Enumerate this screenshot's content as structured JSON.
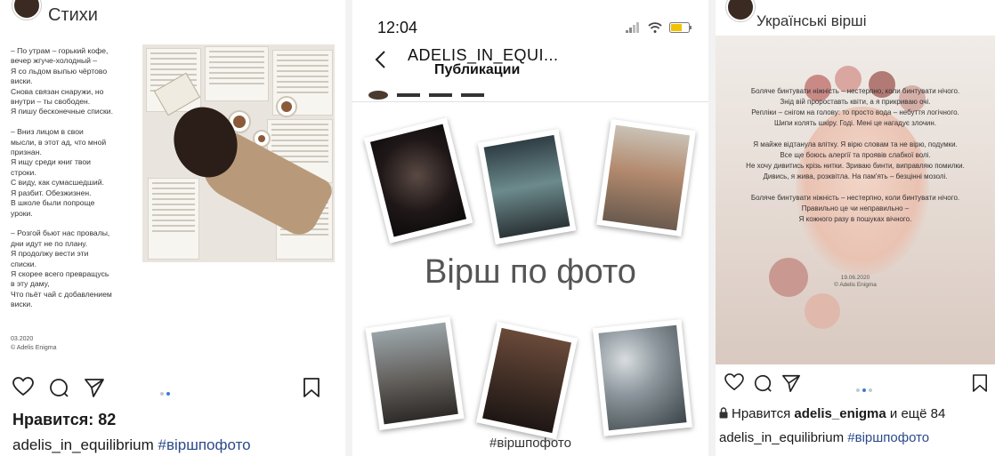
{
  "panel1": {
    "title": "Стихи",
    "poem": "– По утрам – горький кофе,\nвечер жгуче-холодный –\nЯ со льдом выпью чёртово\nвиски.\nСнова связан снаружи, но\nвнутри – ты свободен.\nЯ пишу бесконечные списки.\n\n– Вниз лицом в свои\nмысли, в этот ад, что мной\nпризнан.\nЯ ищу среди книг твои\nстроки.\nС виду, как сумасшедший.\nЯ разбит. Обезжизнен.\nВ школе были попроще\nуроки.\n\n– Розгой бьют нас провалы,\nдни идут не по плану.\nЯ продолжу вести эти\nсписки.\nЯ скорее всего превращусь\nв эту даму,\nЧто пьёт чай с добавлением\nвиски.",
    "signature": "03.2020\n© Adelis Enigma",
    "likes": "Нравится: 82",
    "caption_user": "adelis_in_equilibrium",
    "caption_tag": "#віршпофото"
  },
  "panel2": {
    "time": "12:04",
    "nav_user": "ADELIS_IN_EQUI...",
    "nav_subtitle": "Публикации",
    "main_text": "Вірш по фото",
    "hashtag": "#віршпофото"
  },
  "panel3": {
    "title": "Українські вірші",
    "poem": "Боляче бинтувати ніжність – нестерпно, коли бинтувати нічого.\nЗнід вій пророставть квіти, а я прикриваю очі.\nРепліки – снігом на голову: то просто вода – небуття логічного.\nШипи колять шкіру. Годі. Мені це нагадує злочин.\n\nЯ майже відтанула влітку. Я вірю словам та не вірю, подумки.\nВсе ще боюсь алергії та проявів слабкої волі.\nНе хочу дивитись крізь нитки. Зриваю бинти, виправляю помилки.\nДивись, я жива, розквітла. На пам'ять – безцінні мозолі.\n\nБоляче бинтувати ніжність – нестерпно, коли бинтувати нічого.\nПравильно це чи неправильно –\nЯ кожного разу в пошуках вічного.",
    "signature": "19.06.2020\n© Adelis Enigma",
    "likes_prefix": "Нравится ",
    "likes_user": "adelis_enigma",
    "likes_suffix": " и ещё 84",
    "caption_user": "adelis_in_equilibrium",
    "caption_tag": "#віршпофото"
  },
  "colors": {
    "hashtag": "#2b4a8a",
    "dot_active": "#3b7be0",
    "dot_inactive": "#bfc8d6"
  },
  "icons": [
    "heart-icon",
    "comment-icon",
    "send-icon",
    "bookmark-icon",
    "back-chevron-icon",
    "signal-icon",
    "wifi-icon",
    "battery-icon",
    "lock-icon"
  ]
}
